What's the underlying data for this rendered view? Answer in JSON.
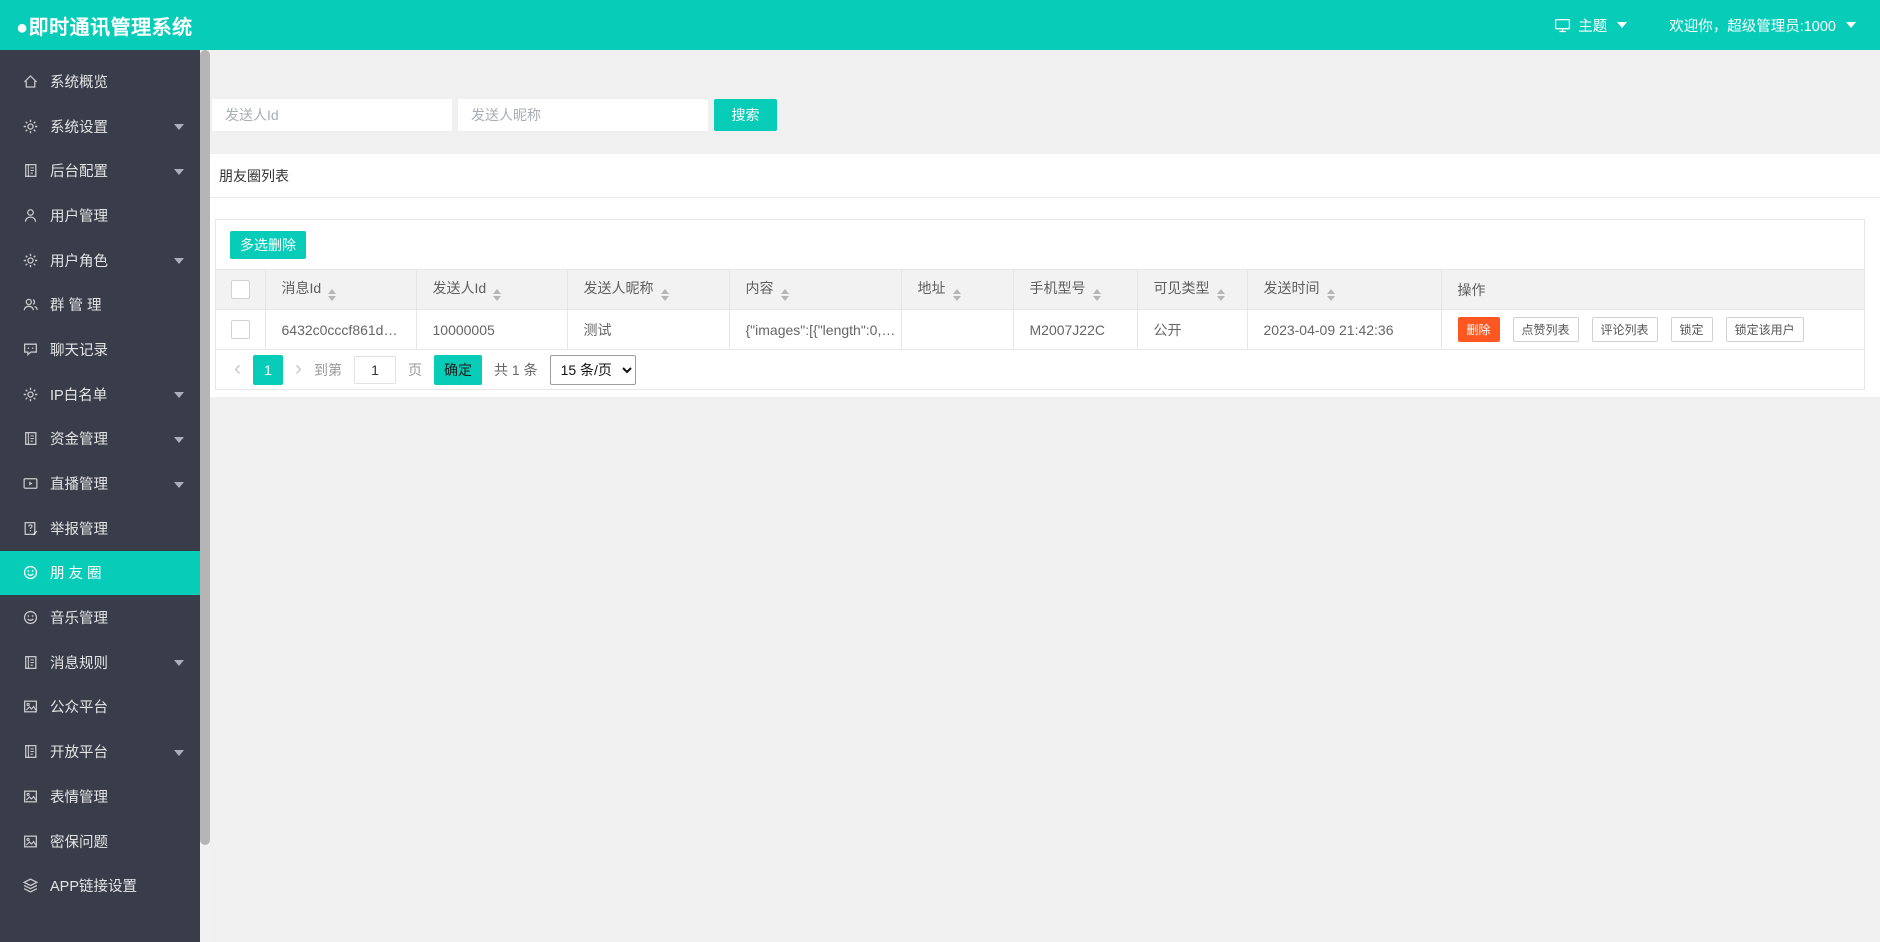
{
  "colors": {
    "teal": "#07CDB8",
    "danger": "#FF5722",
    "sidebar_bg": "#393D49",
    "page_bg": "#F0F0F0"
  },
  "topbar": {
    "title": "●即时通讯管理系统",
    "theme_label": "主题",
    "welcome": "欢迎你，超级管理员:1000"
  },
  "sidebar": {
    "items": [
      {
        "id": "overview",
        "label": "系统概览",
        "icon": "home",
        "chevron": false,
        "active": false
      },
      {
        "id": "system-settings",
        "label": "系统设置",
        "icon": "gear",
        "chevron": true,
        "active": false
      },
      {
        "id": "backend-config",
        "label": "后台配置",
        "icon": "journal",
        "chevron": true,
        "active": false
      },
      {
        "id": "user-mgmt",
        "label": "用户管理",
        "icon": "user",
        "chevron": false,
        "active": false
      },
      {
        "id": "user-roles",
        "label": "用户角色",
        "icon": "gear",
        "chevron": true,
        "active": false
      },
      {
        "id": "group-mgmt",
        "label": "群 管 理",
        "icon": "users",
        "chevron": false,
        "active": false
      },
      {
        "id": "chat-records",
        "label": "聊天记录",
        "icon": "chat",
        "chevron": false,
        "active": false
      },
      {
        "id": "ip-whitelist",
        "label": "IP白名单",
        "icon": "gear",
        "chevron": true,
        "active": false
      },
      {
        "id": "funds-mgmt",
        "label": "资金管理",
        "icon": "journal",
        "chevron": true,
        "active": false
      },
      {
        "id": "live-mgmt",
        "label": "直播管理",
        "icon": "video",
        "chevron": true,
        "active": false
      },
      {
        "id": "report-mgmt",
        "label": "举报管理",
        "icon": "report",
        "chevron": false,
        "active": false
      },
      {
        "id": "moments",
        "label": "朋 友 圈",
        "icon": "smiley",
        "chevron": false,
        "active": true
      },
      {
        "id": "music-mgmt",
        "label": "音乐管理",
        "icon": "smiley",
        "chevron": false,
        "active": false
      },
      {
        "id": "message-rules",
        "label": "消息规则",
        "icon": "journal",
        "chevron": true,
        "active": false
      },
      {
        "id": "public-platform",
        "label": "公众平台",
        "icon": "image",
        "chevron": false,
        "active": false
      },
      {
        "id": "open-platform",
        "label": "开放平台",
        "icon": "journal",
        "chevron": true,
        "active": false
      },
      {
        "id": "emoji-mgmt",
        "label": "表情管理",
        "icon": "image",
        "chevron": false,
        "active": false
      },
      {
        "id": "security-questions",
        "label": "密保问题",
        "icon": "image",
        "chevron": false,
        "active": false
      },
      {
        "id": "app-link-settings",
        "label": "APP链接设置",
        "icon": "layers",
        "chevron": false,
        "active": false
      }
    ]
  },
  "search": {
    "sender_id_placeholder": "发送人Id",
    "nickname_placeholder": "发送人昵称",
    "button_label": "搜索"
  },
  "panel": {
    "title": "朋友圈列表",
    "bulk_delete_label": "多选删除"
  },
  "table": {
    "columns": [
      {
        "label": "消息Id",
        "sortable": true
      },
      {
        "label": "发送人Id",
        "sortable": true
      },
      {
        "label": "发送人昵称",
        "sortable": true
      },
      {
        "label": "内容",
        "sortable": true
      },
      {
        "label": "地址",
        "sortable": true
      },
      {
        "label": "手机型号",
        "sortable": true
      },
      {
        "label": "可见类型",
        "sortable": true
      },
      {
        "label": "发送时间",
        "sortable": true
      },
      {
        "label": "操作",
        "sortable": false
      }
    ],
    "rows": [
      {
        "cells": [
          "6432c0cccf861d…",
          "10000005",
          "测试",
          "{\"images\":[{\"length\":0,…",
          "",
          "M2007J22C",
          "公开",
          "2023-04-09 21:42:36"
        ],
        "actions": [
          {
            "label": "删除",
            "type": "danger"
          },
          {
            "label": "点赞列表",
            "type": "plain"
          },
          {
            "label": "评论列表",
            "type": "plain"
          },
          {
            "label": "锁定",
            "type": "plain"
          },
          {
            "label": "锁定该用户",
            "type": "plain"
          }
        ]
      }
    ]
  },
  "pagination": {
    "prev": "‹",
    "page": "1",
    "next": "›",
    "jump_prefix": "到第",
    "jump_value": "1",
    "jump_suffix": "页",
    "confirm_label": "确定",
    "total": "共 1 条",
    "page_size_option": "15 条/页"
  }
}
